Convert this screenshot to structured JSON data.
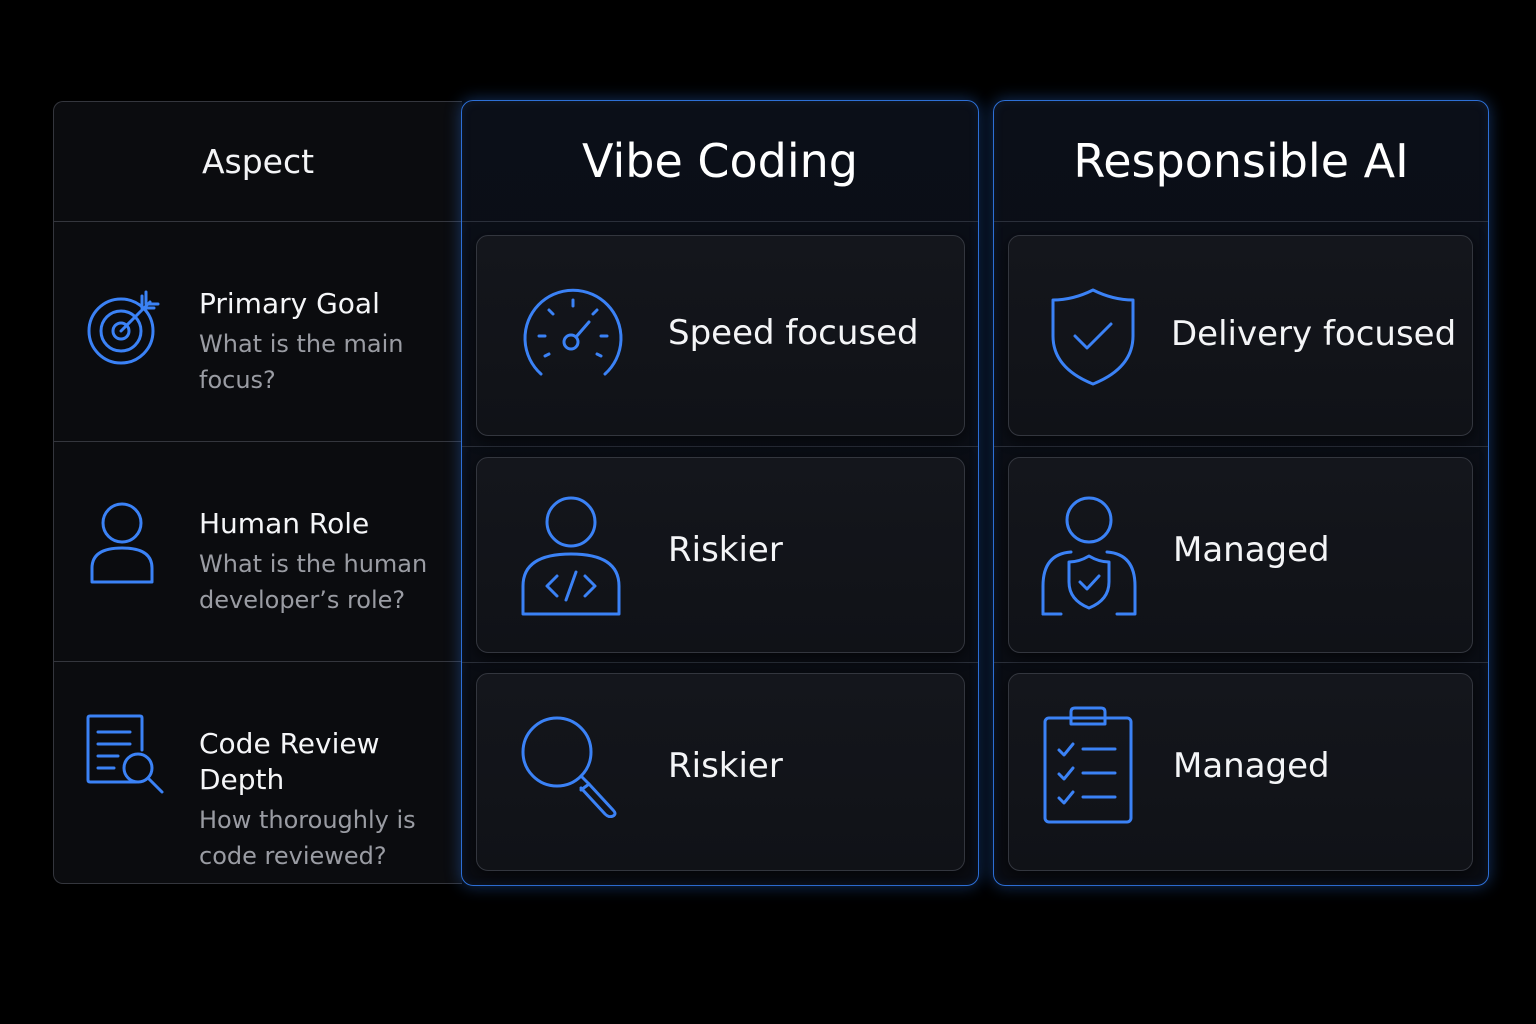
{
  "columns": {
    "aspect": "Aspect",
    "vibe": "Vibe Coding",
    "responsible": "Responsible AI"
  },
  "rows": [
    {
      "title": "Primary Goal",
      "sub1": "What is the main",
      "sub2": "focus?",
      "icon": "target-icon",
      "vibe": {
        "label": "Speed focused",
        "icon": "speedometer-icon"
      },
      "responsible": {
        "label": "Delivery focused",
        "icon": "shield-check-icon"
      }
    },
    {
      "title": "Human Role",
      "sub1": "What is the human",
      "sub2": "developer’s role?",
      "icon": "user-icon",
      "vibe": {
        "label": "Riskier",
        "icon": "user-code-icon"
      },
      "responsible": {
        "label": "Managed",
        "icon": "user-shield-icon"
      }
    },
    {
      "title": "Code Review Depth",
      "sub1": "How thoroughly is",
      "sub2": "code reviewed?",
      "icon": "document-search-icon",
      "vibe": {
        "label": "Riskier",
        "icon": "magnifier-icon"
      },
      "responsible": {
        "label": "Managed",
        "icon": "clipboard-checklist-icon"
      }
    }
  ],
  "colors": {
    "accent": "#3b82f6",
    "border": "#2d6fd6",
    "background": "#000000"
  }
}
